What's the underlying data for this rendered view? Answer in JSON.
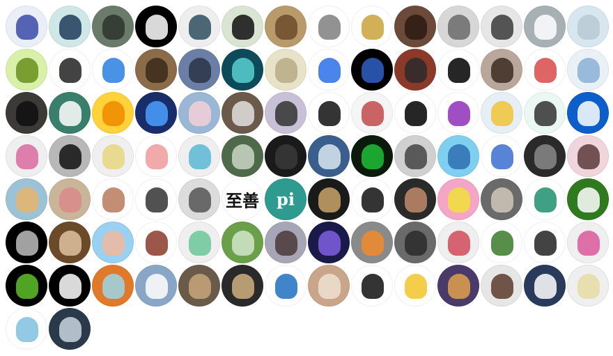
{
  "contributors": [
    {
      "bg": "#e9eef7",
      "fg": "#3b4aa8",
      "label": "",
      "img": "pixel-face"
    },
    {
      "bg": "#cfe7e6",
      "fg": "#1f3b5b",
      "label": "",
      "img": "heart-key"
    },
    {
      "bg": "#6b7b6b",
      "fg": "#2d352d",
      "label": "",
      "img": "selfie"
    },
    {
      "bg": "#000000",
      "fg": "#ffffff",
      "label": "",
      "img": "github"
    },
    {
      "bg": "#eeeeee",
      "fg": "#2e4f5f",
      "label": "",
      "img": "gopher-glasses"
    },
    {
      "bg": "#d9e4d2",
      "fg": "#111111",
      "label": "",
      "img": "panda"
    },
    {
      "bg": "#b99a6b",
      "fg": "#6b4b2a",
      "label": "",
      "img": "dog"
    },
    {
      "bg": "#ffffff",
      "fg": "#7f7f7f",
      "label": "",
      "img": "sword"
    },
    {
      "bg": "#ffffff",
      "fg": "#c9a23a",
      "label": "",
      "img": "megaminx"
    },
    {
      "bg": "#6b4a3a",
      "fg": "#2b1a12",
      "label": "",
      "img": "man-glasses"
    },
    {
      "bg": "#d7d7d7",
      "fg": "#6b6b6b",
      "label": "",
      "img": "anime-boy"
    },
    {
      "bg": "#e6e6e6",
      "fg": "#3a3a3a",
      "label": "",
      "img": "man-portrait"
    },
    {
      "bg": "#a7b1b3",
      "fg": "#ffffff",
      "label": "",
      "img": "mountains"
    },
    {
      "bg": "#d8e6ef",
      "fg": "#b8c9d5",
      "label": "",
      "img": "city-mist"
    },
    {
      "bg": "#d8f0a8",
      "fg": "#6b8f1f",
      "label": "",
      "img": "anime-green"
    },
    {
      "bg": "#ffffff",
      "fg": "#222222",
      "label": "",
      "img": "hooded"
    },
    {
      "bg": "#ffffff",
      "fg": "#2a7fe0",
      "label": "",
      "img": "checklist"
    },
    {
      "bg": "#8a6b4a",
      "fg": "#3a2a1a",
      "label": "",
      "img": "anime-brown"
    },
    {
      "bg": "#6b7fa6",
      "fg": "#2a3446",
      "label": "",
      "img": "spider"
    },
    {
      "bg": "#0e4b5a",
      "fg": "#58d0d0",
      "label": "",
      "img": "silhouette"
    },
    {
      "bg": "#e8e2c9",
      "fg": "#b7aa86",
      "label": "",
      "img": "blurred"
    },
    {
      "bg": "#ffffff",
      "fg": "#2c6ee8",
      "label": "",
      "img": "coder"
    },
    {
      "bg": "#000000",
      "fg": "#2f5fc6",
      "label": "",
      "img": "fish"
    },
    {
      "bg": "#8b3a2a",
      "fg": "#2a2a2a",
      "label": "",
      "img": "soldier"
    },
    {
      "bg": "#ffffff",
      "fg": "#000000",
      "label": "",
      "img": "glasses-face"
    },
    {
      "bg": "#b8a79a",
      "fg": "#3b2b22",
      "label": "",
      "img": "anime-boy2"
    },
    {
      "bg": "#ffffff",
      "fg": "#d94a4a",
      "label": "",
      "img": "cartoon-boy"
    },
    {
      "bg": "#e9f1f7",
      "fg": "#8ab2d6",
      "label": "",
      "img": "wave"
    },
    {
      "bg": "#3b3a36",
      "fg": "#0f0f0f",
      "label": "",
      "img": "hood-man"
    },
    {
      "bg": "#3a7f6b",
      "fg": "#ffffff",
      "label": "",
      "img": "robot"
    },
    {
      "bg": "#ffd23a",
      "fg": "#f08a00",
      "label": "",
      "img": "dragonball"
    },
    {
      "bg": "#1a2d6b",
      "fg": "#4aa0ff",
      "label": "",
      "img": "night-city"
    },
    {
      "bg": "#9bb7d6",
      "fg": "#f2d0d6",
      "label": "",
      "img": "pig"
    },
    {
      "bg": "#6b5a4a",
      "fg": "#e0e0e0",
      "label": "",
      "img": "cat-laptop"
    },
    {
      "bg": "#c7c0d6",
      "fg": "#333333",
      "label": "",
      "img": "girl"
    },
    {
      "bg": "#ffffff",
      "fg": "#111111",
      "label": "",
      "img": "man-cartoon"
    },
    {
      "bg": "#f5f5f5",
      "fg": "#c24a4a",
      "label": "",
      "img": "cat-sticker"
    },
    {
      "bg": "#ffffff",
      "fg": "#000000",
      "label": "",
      "img": "kawaii"
    },
    {
      "bg": "#ffffff",
      "fg": "#8f2fb8",
      "label": "",
      "img": "purple-cat"
    },
    {
      "bg": "#e6eef6",
      "fg": "#f0c43a",
      "label": "",
      "img": "kid"
    },
    {
      "bg": "#eaf7f2",
      "fg": "#333333",
      "label": "",
      "img": "small-cat"
    },
    {
      "bg": "#0c5fcb",
      "fg": "#ffffff",
      "label": "",
      "img": "bot"
    },
    {
      "bg": "#efefef",
      "fg": "#d96aa0",
      "label": "",
      "img": "identicon-pink"
    },
    {
      "bg": "#b8b8b8",
      "fg": "#111111",
      "label": "",
      "img": "man-smile"
    },
    {
      "bg": "#efefef",
      "fg": "#e6d680",
      "label": "",
      "img": "identicon-yellow"
    },
    {
      "bg": "#ffffff",
      "fg": "#f09a9a",
      "label": "",
      "img": "togepi"
    },
    {
      "bg": "#efefef",
      "fg": "#5ab7d6",
      "label": "",
      "img": "identicon-blue"
    },
    {
      "bg": "#4f6a4a",
      "fg": "#c9d6c6",
      "label": "",
      "img": "person-green"
    },
    {
      "bg": "#1a1a1a",
      "fg": "#3a3a3a",
      "label": "",
      "img": "dark"
    },
    {
      "bg": "#3a5f8f",
      "fg": "#d9e6ef",
      "label": "",
      "img": "person-sea"
    },
    {
      "bg": "#0b1a0b",
      "fg": "#1fbf3a",
      "label": "",
      "img": "matrix"
    },
    {
      "bg": "#d0d0d0",
      "fg": "#444444",
      "label": "",
      "img": "anime-white"
    },
    {
      "bg": "#7fd0f0",
      "fg": "#2f6fb0",
      "label": "",
      "img": "beach"
    },
    {
      "bg": "#ffffff",
      "fg": "#3a6fd0",
      "label": "",
      "img": "anime-blue"
    },
    {
      "bg": "#2a2a2a",
      "fg": "#888888",
      "label": "",
      "img": "piano"
    },
    {
      "bg": "#f0d6dc",
      "fg": "#5a3a3a",
      "label": "",
      "img": "girl-cartoon"
    },
    {
      "bg": "#9cc2d6",
      "fg": "#e8b46a",
      "label": "",
      "img": "sea-sunset"
    },
    {
      "bg": "#c9b59a",
      "fg": "#d98a8a",
      "label": "",
      "img": "pig2"
    },
    {
      "bg": "#ffffff",
      "fg": "#b87a5a",
      "label": "",
      "img": "cartoon-hat"
    },
    {
      "bg": "#ffffff",
      "fg": "#333333",
      "label": "",
      "img": "tree"
    },
    {
      "bg": "#dcdcdc",
      "fg": "#555555",
      "label": "",
      "img": "cat-face"
    },
    {
      "bg": "#ffffff",
      "fg": "#111111",
      "label": "至善",
      "img": "text"
    },
    {
      "bg": "#2f9a8f",
      "fg": "#ffffff",
      "label": "pi",
      "img": "text"
    },
    {
      "bg": "#1a1a1a",
      "fg": "#c9a56a",
      "label": "",
      "img": "mask"
    },
    {
      "bg": "#ffffff",
      "fg": "#111111",
      "label": "",
      "img": "batman-penguin"
    },
    {
      "bg": "#2a2a2a",
      "fg": "#c08a6a",
      "label": "",
      "img": "person-dark"
    },
    {
      "bg": "#f5a5c5",
      "fg": "#f0e13a",
      "label": "",
      "img": "spongebob"
    },
    {
      "bg": "#6a6a6a",
      "fg": "#d0c7b8",
      "label": "",
      "img": "castle"
    },
    {
      "bg": "#ffffff",
      "fg": "#1f8f6f",
      "label": "",
      "img": "chibi"
    },
    {
      "bg": "#2f7a1f",
      "fg": "#ffffff",
      "label": "",
      "img": "green-face"
    },
    {
      "bg": "#000000",
      "fg": "#bdbdbd",
      "label": "",
      "img": "wings"
    },
    {
      "bg": "#6b4a2a",
      "fg": "#e0c2a0",
      "label": "",
      "img": "man-outdoor"
    },
    {
      "bg": "#9ad0f0",
      "fg": "#f0b8a0",
      "label": "",
      "img": "bald-glasses"
    },
    {
      "bg": "#ffffff",
      "fg": "#8a3a2a",
      "label": "",
      "img": "cup-cat"
    },
    {
      "bg": "#efefef",
      "fg": "#6ac79a",
      "label": "",
      "img": "identicon-green"
    },
    {
      "bg": "#6aa04a",
      "fg": "#d0e6c9",
      "label": "",
      "img": "man-glasses2"
    },
    {
      "bg": "#a6a6b6",
      "fg": "#4a3a3a",
      "label": "",
      "img": "girl-drawn"
    },
    {
      "bg": "#1a1a4a",
      "fg": "#7f5fe0",
      "label": "",
      "img": "night-tower"
    },
    {
      "bg": "#8a8a8a",
      "fg": "#f08a2a",
      "label": "",
      "img": "pumpkin"
    },
    {
      "bg": "#6a6a6a",
      "fg": "#2a2a2a",
      "label": "",
      "img": "man-stand"
    },
    {
      "bg": "#efefef",
      "fg": "#d04a5a",
      "label": "",
      "img": "identicon-red"
    },
    {
      "bg": "#ffffff",
      "fg": "#3a7a2a",
      "label": "",
      "img": "zelda"
    },
    {
      "bg": "#ffffff",
      "fg": "#222222",
      "label": "",
      "img": "panda-small"
    },
    {
      "bg": "#efefef",
      "fg": "#d95a9a",
      "label": "",
      "img": "identicon-magenta"
    },
    {
      "bg": "#000000",
      "fg": "#5fbf2a",
      "label": "",
      "img": "sprout"
    },
    {
      "bg": "#000000",
      "fg": "#ffffff",
      "label": "",
      "img": "m-logo"
    },
    {
      "bg": "#e07a2a",
      "fg": "#9ad6e6",
      "label": "",
      "img": "rick"
    },
    {
      "bg": "#8aa6c6",
      "fg": "#ffffff",
      "label": "",
      "img": "person-blur"
    },
    {
      "bg": "#6a5a4a",
      "fg": "#c8a67a",
      "label": "",
      "img": "cat-stair"
    },
    {
      "bg": "#2a2a2a",
      "fg": "#d0b080",
      "label": "",
      "img": "man-sunglasses"
    },
    {
      "bg": "#ffffff",
      "fg": "#1f6fbf",
      "label": "",
      "img": "hat-bird"
    },
    {
      "bg": "#c9a58a",
      "fg": "#f0e0d0",
      "label": "",
      "img": "kittens"
    },
    {
      "bg": "#ffffff",
      "fg": "#111111",
      "label": "",
      "img": "pixel-man"
    },
    {
      "bg": "#ffffff",
      "fg": "#f2c42a",
      "label": "",
      "img": "yellow-cat"
    },
    {
      "bg": "#4a3a6a",
      "fg": "#e0a04a",
      "label": "",
      "img": "guitar"
    },
    {
      "bg": "#e6e6e6",
      "fg": "#5a3a2a",
      "label": "",
      "img": "cartoon-man"
    },
    {
      "bg": "#2a3a5a",
      "fg": "#ffffff",
      "label": "",
      "img": "soccer"
    },
    {
      "bg": "#efefef",
      "fg": "#e6dca6",
      "label": "",
      "img": "identicon-tan"
    },
    {
      "bg": "#ffffff",
      "fg": "#7fc0e0",
      "label": "",
      "img": "gopher"
    },
    {
      "bg": "#2a3a4a",
      "fg": "#c9d6e0",
      "label": "",
      "img": "horse"
    }
  ]
}
